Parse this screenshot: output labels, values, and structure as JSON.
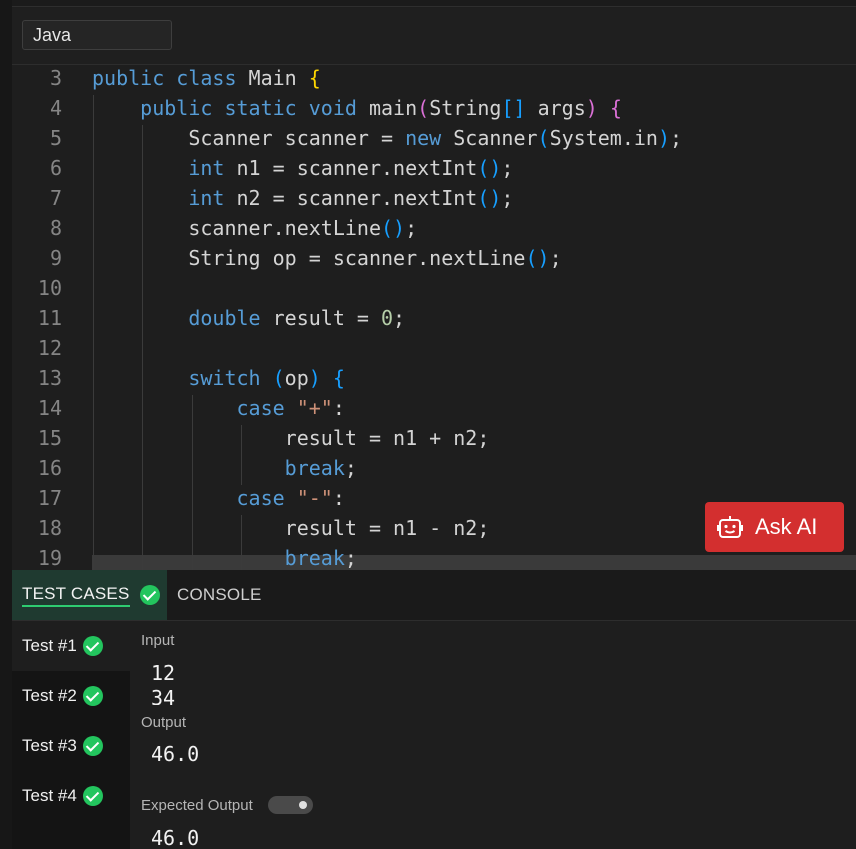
{
  "language": {
    "selected": "Java"
  },
  "code_lines": [
    {
      "n": "3",
      "tokens": [
        [
          "kw",
          "public"
        ],
        [
          "",
          " "
        ],
        [
          "kw",
          "class"
        ],
        [
          "",
          " Main "
        ],
        [
          "br1",
          "{"
        ]
      ]
    },
    {
      "n": "4",
      "tokens": [
        [
          "",
          "    "
        ],
        [
          "kw",
          "public"
        ],
        [
          "",
          " "
        ],
        [
          "kw",
          "static"
        ],
        [
          "",
          " "
        ],
        [
          "kw",
          "void"
        ],
        [
          "",
          " main"
        ],
        [
          "br2",
          "("
        ],
        [
          "",
          "String"
        ],
        [
          "br3",
          "[]"
        ],
        [
          "",
          " args"
        ],
        [
          "br2",
          ")"
        ],
        [
          "",
          " "
        ],
        [
          "br2",
          "{"
        ]
      ]
    },
    {
      "n": "5",
      "tokens": [
        [
          "",
          "        Scanner scanner = "
        ],
        [
          "kw",
          "new"
        ],
        [
          "",
          " Scanner"
        ],
        [
          "br3",
          "("
        ],
        [
          "",
          "System.in"
        ],
        [
          "br3",
          ")"
        ],
        [
          "",
          ";"
        ]
      ]
    },
    {
      "n": "6",
      "tokens": [
        [
          "",
          "        "
        ],
        [
          "kw",
          "int"
        ],
        [
          "",
          " n1 = scanner.nextInt"
        ],
        [
          "br3",
          "()"
        ],
        [
          "",
          ";"
        ]
      ]
    },
    {
      "n": "7",
      "tokens": [
        [
          "",
          "        "
        ],
        [
          "kw",
          "int"
        ],
        [
          "",
          " n2 = scanner.nextInt"
        ],
        [
          "br3",
          "()"
        ],
        [
          "",
          ";"
        ]
      ]
    },
    {
      "n": "8",
      "tokens": [
        [
          "",
          "        scanner.nextLine"
        ],
        [
          "br3",
          "()"
        ],
        [
          "",
          ";"
        ]
      ]
    },
    {
      "n": "9",
      "tokens": [
        [
          "",
          "        String op = scanner.nextLine"
        ],
        [
          "br3",
          "()"
        ],
        [
          "",
          ";"
        ]
      ]
    },
    {
      "n": "10",
      "tokens": []
    },
    {
      "n": "11",
      "tokens": [
        [
          "",
          "        "
        ],
        [
          "kw",
          "double"
        ],
        [
          "",
          " result = "
        ],
        [
          "num",
          "0"
        ],
        [
          "",
          ";"
        ]
      ]
    },
    {
      "n": "12",
      "tokens": []
    },
    {
      "n": "13",
      "tokens": [
        [
          "",
          "        "
        ],
        [
          "kw",
          "switch"
        ],
        [
          "",
          " "
        ],
        [
          "br3",
          "("
        ],
        [
          "",
          "op"
        ],
        [
          "br3",
          ")"
        ],
        [
          "",
          " "
        ],
        [
          "br3",
          "{"
        ]
      ]
    },
    {
      "n": "14",
      "tokens": [
        [
          "",
          "            "
        ],
        [
          "kw",
          "case"
        ],
        [
          "",
          " "
        ],
        [
          "str",
          "\"+\""
        ],
        [
          "",
          ":"
        ]
      ]
    },
    {
      "n": "15",
      "tokens": [
        [
          "",
          "                result = n1 + n2;"
        ]
      ]
    },
    {
      "n": "16",
      "tokens": [
        [
          "",
          "                "
        ],
        [
          "kw",
          "break"
        ],
        [
          "",
          ";"
        ]
      ]
    },
    {
      "n": "17",
      "tokens": [
        [
          "",
          "            "
        ],
        [
          "kw",
          "case"
        ],
        [
          "",
          " "
        ],
        [
          "str",
          "\"-\""
        ],
        [
          "",
          ":"
        ]
      ]
    },
    {
      "n": "18",
      "tokens": [
        [
          "",
          "                result = n1 - n2;"
        ]
      ]
    },
    {
      "n": "19",
      "tokens": [
        [
          "",
          "                "
        ],
        [
          "kw",
          "break"
        ],
        [
          "",
          ";"
        ]
      ]
    }
  ],
  "ask_ai": {
    "label": "Ask AI",
    "icon": "robot-icon"
  },
  "panel_tabs": {
    "test_cases": "TEST CASES",
    "console": "CONSOLE"
  },
  "tests": [
    {
      "label": "Test #1",
      "passed": true
    },
    {
      "label": "Test #2",
      "passed": true
    },
    {
      "label": "Test #3",
      "passed": true
    },
    {
      "label": "Test #4",
      "passed": true
    }
  ],
  "selected_test": {
    "input_label": "Input",
    "input_lines": [
      "12",
      "34"
    ],
    "output_label": "Output",
    "output_value": "46.0",
    "expected_label": "Expected Output",
    "expected_value": "46.0"
  },
  "colors": {
    "accent_green": "#23c55e",
    "ask_ai_red": "#d32f2f"
  }
}
